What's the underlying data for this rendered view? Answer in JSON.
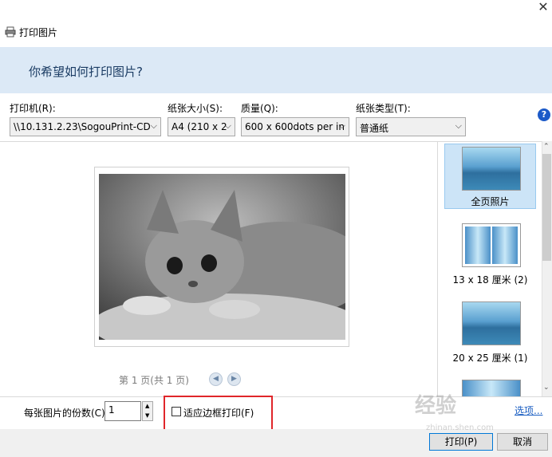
{
  "window": {
    "title": "打印图片",
    "close_glyph": "✕"
  },
  "banner": {
    "heading": "你希望如何打印图片?"
  },
  "settings": {
    "printer_label": "打印机(R):",
    "printer_value": "\\\\10.131.2.23\\SogouPrint-CD",
    "paper_size_label": "纸张大小(S):",
    "paper_size_value": "A4 (210 x 2",
    "quality_label": "质量(Q):",
    "quality_value": "600 x 600dots per in",
    "paper_type_label": "纸张类型(T):",
    "paper_type_value": "普通纸"
  },
  "preview": {
    "page_info": "第 1 页(共 1 页)",
    "prev_glyph": "◀",
    "next_glyph": "▶"
  },
  "layouts": [
    {
      "label": "全页照片",
      "selected": true
    },
    {
      "label": "13 x 18 厘米 (2)",
      "selected": false
    },
    {
      "label": "20 x 25 厘米 (1)",
      "selected": false
    }
  ],
  "bottom": {
    "copies_label": "每张图片的份数(C):",
    "copies_value": "1",
    "fit_label": "适应边框打印(F)",
    "fit_checked": false,
    "options_link": "选项..."
  },
  "footer": {
    "print_button": "打印(P)",
    "cancel_button": "取消"
  },
  "watermark": {
    "text": "经验",
    "url": "zhinan.shen.com"
  },
  "colors": {
    "banner_bg": "#dce9f6",
    "highlight": "#e0262a",
    "link": "#1a5ec2"
  }
}
